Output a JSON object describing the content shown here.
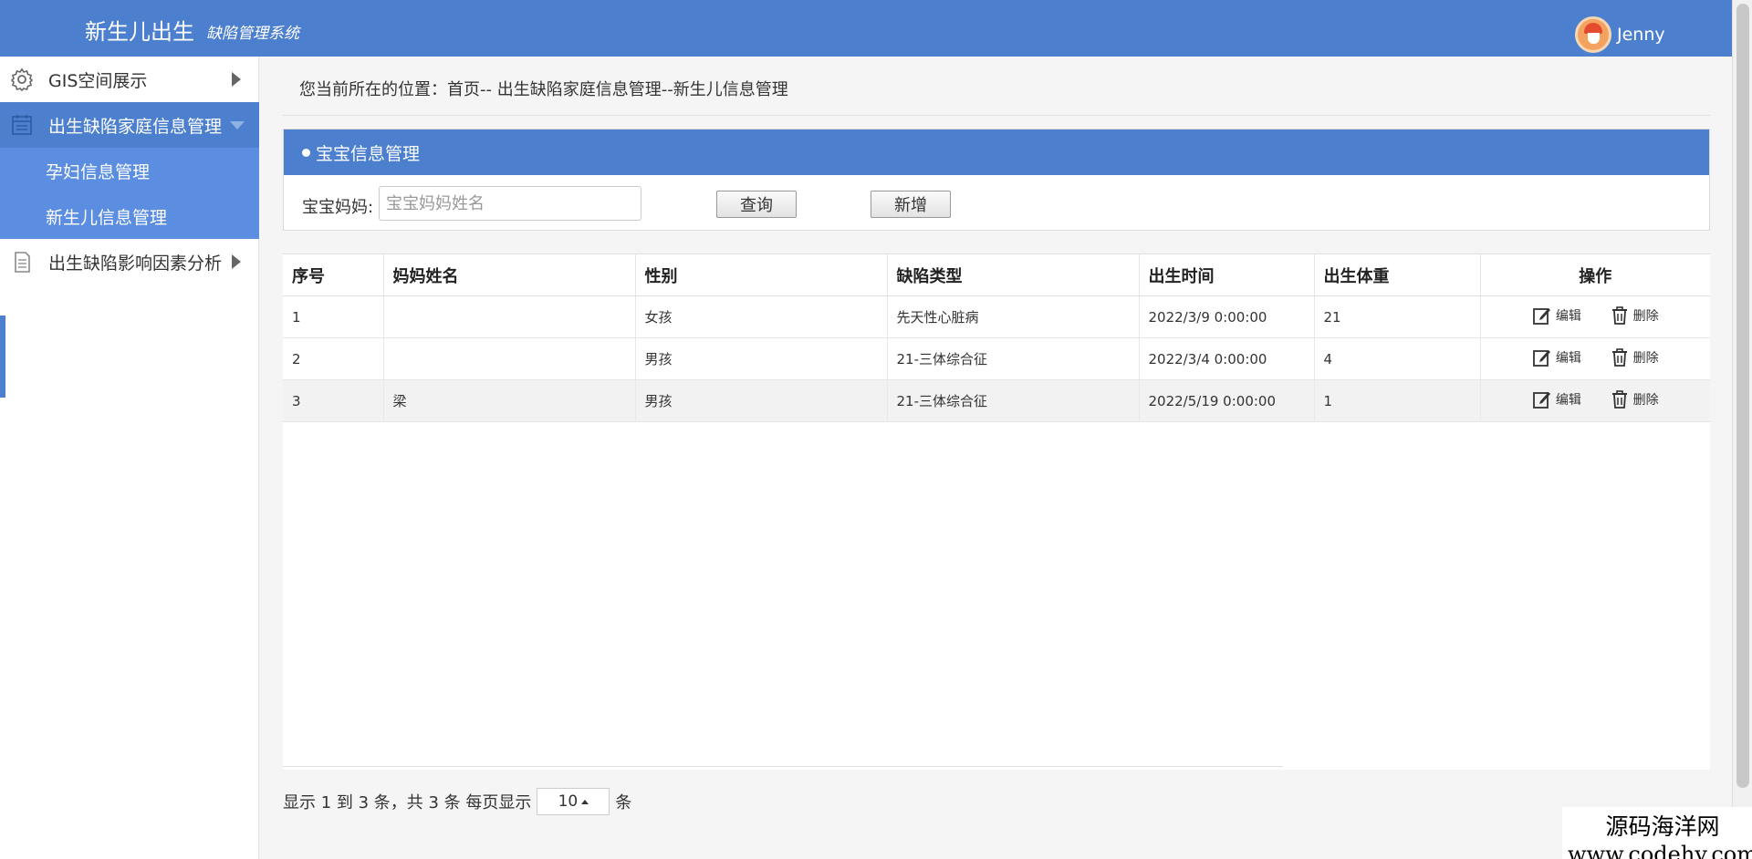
{
  "header": {
    "title": "新生儿出生",
    "subtitle": "缺陷管理系统",
    "user_name": "Jenny",
    "bg_color": "#4c80cf"
  },
  "sidebar": {
    "items": [
      {
        "label": "GIS空间展示",
        "icon": "gear-icon"
      },
      {
        "label": "出生缺陷家庭信息管理",
        "icon": "calendar-icon",
        "active": true
      },
      {
        "label": "出生缺陷影响因素分析",
        "icon": "document-icon"
      }
    ],
    "sub_items": [
      {
        "label": "孕妇信息管理"
      },
      {
        "label": "新生儿信息管理"
      }
    ]
  },
  "breadcrumb": "您当前所在的位置：首页--   出生缺陷家庭信息管理--新生儿信息管理",
  "panel": {
    "title": "宝宝信息管理",
    "search_label": "宝宝妈妈:",
    "search_placeholder": "宝宝妈妈姓名",
    "search_value": "",
    "query_label": "查询",
    "add_label": "新增"
  },
  "table": {
    "headers": [
      "序号",
      "妈妈姓名",
      "性别",
      "缺陷类型",
      "出生时间",
      "出生体重",
      "操作"
    ],
    "rows": [
      {
        "id": "1",
        "mother": "",
        "gender": "女孩",
        "defect": "先天性心脏病",
        "birth_time": "2022/3/9 0:00:00",
        "weight": "21"
      },
      {
        "id": "2",
        "mother": "",
        "gender": "男孩",
        "defect": "21-三体综合征",
        "birth_time": "2022/3/4 0:00:00",
        "weight": "4"
      },
      {
        "id": "3",
        "mother": "梁",
        "gender": "男孩",
        "defect": "21-三体综合征",
        "birth_time": "2022/5/19 0:00:00",
        "weight": "1"
      }
    ],
    "edit_label": "编辑",
    "delete_label": "删除"
  },
  "pager": {
    "summary": "显示 1 到 3 条，共 3 条  每页显示",
    "page_size": "10",
    "unit": "条"
  },
  "watermark": {
    "line1": "源码海洋网",
    "line2": "www.codehy.com"
  }
}
